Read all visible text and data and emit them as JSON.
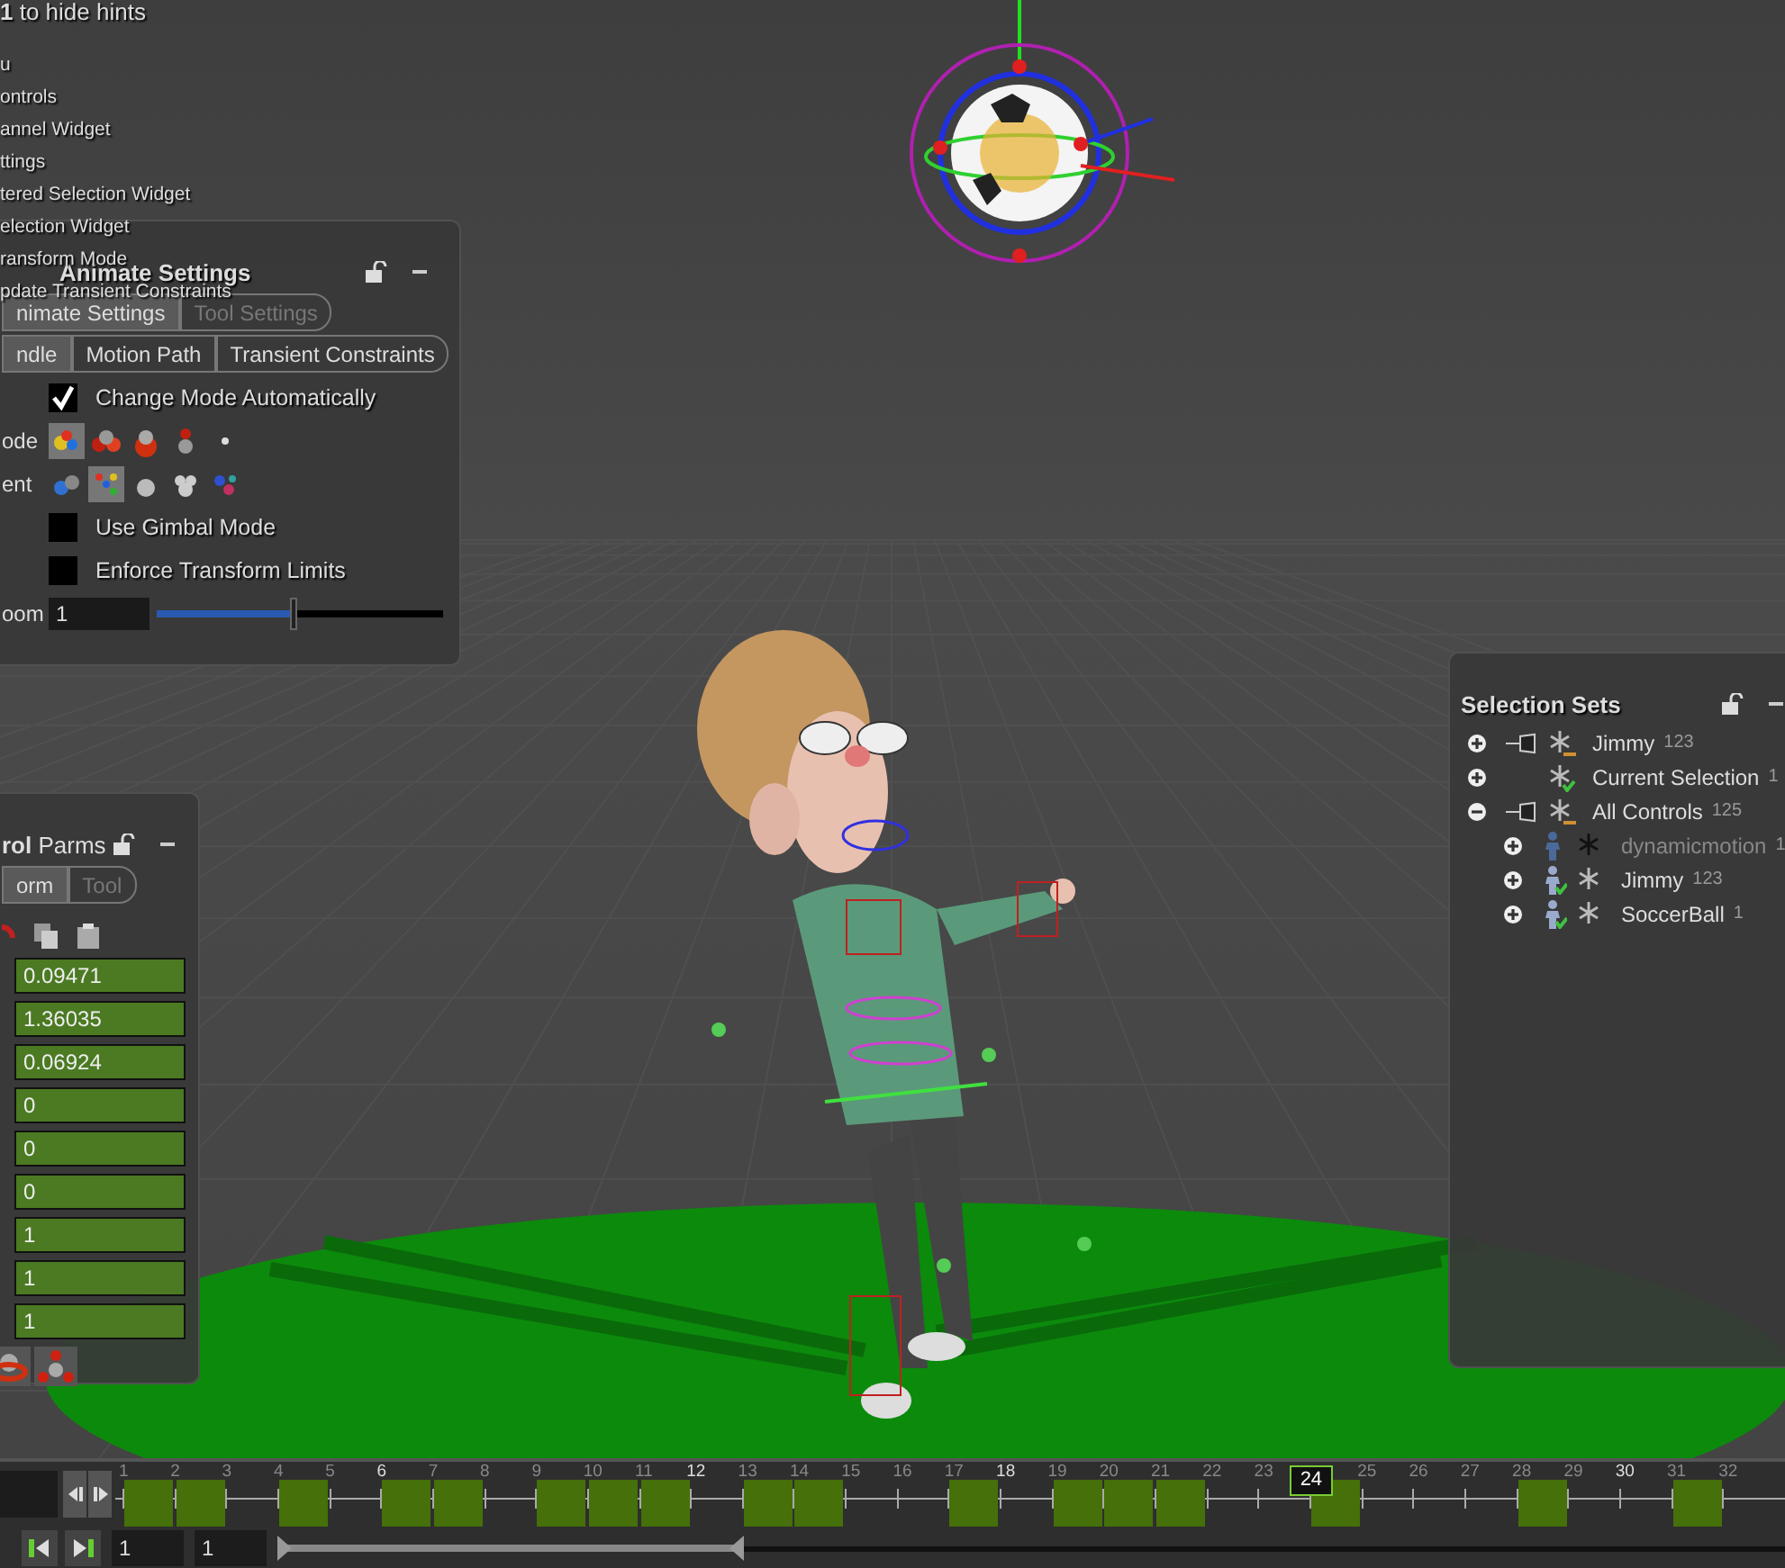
{
  "hints": {
    "title": "**1** to hide hints",
    "items": [
      "u",
      "ontrols",
      "annel Widget",
      "ttings",
      "tered Selection Widget",
      "election Widget",
      "ransform Mode",
      "pdate Transient Constraints"
    ]
  },
  "animate_settings": {
    "title": "Animate Settings",
    "tabs": [
      {
        "label": "nimate Settings",
        "selected": true
      },
      {
        "label": "Tool Settings",
        "selected": false
      }
    ],
    "subtabs": [
      {
        "label": "ndle",
        "selected": true
      },
      {
        "label": "Motion Path",
        "selected": false
      },
      {
        "label": "Transient Constraints",
        "selected": false
      }
    ],
    "rows": [
      {
        "kind": "checkbox",
        "label": "Change Mode Automatically",
        "checked": true
      },
      {
        "kind": "icons",
        "label": "ode",
        "icons": [
          {
            "selected": true
          },
          {
            "selected": false
          },
          {
            "selected": false
          },
          {
            "selected": false
          },
          {
            "selected": false
          }
        ]
      },
      {
        "kind": "icons",
        "label": "ent",
        "icons": [
          {
            "selected": false
          },
          {
            "selected": true
          },
          {
            "selected": false
          },
          {
            "selected": false
          },
          {
            "selected": false
          }
        ]
      },
      {
        "kind": "checkbox",
        "label": "Use Gimbal Mode",
        "checked": false
      },
      {
        "kind": "checkbox",
        "label": "Enforce Transform Limits",
        "checked": false
      },
      {
        "kind": "slider",
        "label": "oom",
        "value": "1",
        "level": 0.48
      }
    ]
  },
  "control_parms": {
    "title": "**rol** Parms",
    "tabs": [
      {
        "label": "orm",
        "selected": true
      },
      {
        "label": "Tool",
        "selected": false
      }
    ],
    "fields": [
      "0.09471",
      "1.36035",
      "0.06924",
      "0",
      "0",
      "0",
      "1",
      "1",
      "1"
    ]
  },
  "selection_sets": {
    "title": "Selection Sets",
    "items": [
      {
        "kind": "set",
        "label": "Jimmy",
        "count": "123",
        "expanded": false,
        "dimmed": false
      },
      {
        "kind": "selection",
        "label": "Current Selection",
        "count": "1",
        "expanded": false,
        "dimmed": false
      },
      {
        "kind": "set",
        "label": "All Controls",
        "count": "125",
        "expanded": true,
        "dimmed": false,
        "children": [
          {
            "kind": "character",
            "label": "dynamicmotion",
            "count": "1",
            "expanded": false,
            "dimmed": true
          },
          {
            "kind": "character",
            "label": "Jimmy",
            "count": "123",
            "expanded": false,
            "dimmed": false
          },
          {
            "kind": "character",
            "label": "SoccerBall",
            "count": "1",
            "expanded": false,
            "dimmed": false
          }
        ]
      }
    ]
  },
  "timeline": {
    "frames": [
      {
        "label": "1",
        "key": true,
        "selected": false
      },
      {
        "label": "2",
        "key": true,
        "selected": false
      },
      {
        "label": "3",
        "key": false,
        "selected": false
      },
      {
        "label": "4",
        "key": true,
        "selected": false
      },
      {
        "label": "5",
        "key": false,
        "selected": false
      },
      {
        "label": "6",
        "key": true,
        "selected": false
      },
      {
        "label": "7",
        "key": true,
        "selected": false
      },
      {
        "label": "8",
        "key": false,
        "selected": false
      },
      {
        "label": "9",
        "key": true,
        "selected": false
      },
      {
        "label": "10",
        "key": true,
        "selected": false
      },
      {
        "label": "11",
        "key": true,
        "selected": false
      },
      {
        "label": "12",
        "key": false,
        "selected": false
      },
      {
        "label": "13",
        "key": true,
        "selected": false
      },
      {
        "label": "14",
        "key": true,
        "selected": false
      },
      {
        "label": "15",
        "key": false,
        "selected": false
      },
      {
        "label": "16",
        "key": false,
        "selected": false
      },
      {
        "label": "17",
        "key": true,
        "selected": false
      },
      {
        "label": "18",
        "key": false,
        "selected": false
      },
      {
        "label": "19",
        "key": true,
        "selected": false
      },
      {
        "label": "20",
        "key": true,
        "selected": false
      },
      {
        "label": "21",
        "key": true,
        "selected": false
      },
      {
        "label": "22",
        "key": false,
        "selected": false
      },
      {
        "label": "23",
        "key": false,
        "selected": false
      },
      {
        "label": "24",
        "key": true,
        "selected": true
      },
      {
        "label": "25",
        "key": false,
        "selected": false
      },
      {
        "label": "26",
        "key": false,
        "selected": false
      },
      {
        "label": "27",
        "key": false,
        "selected": false
      },
      {
        "label": "28",
        "key": true,
        "selected": false
      },
      {
        "label": "29",
        "key": false,
        "selected": false
      },
      {
        "label": "30",
        "key": false,
        "selected": false
      },
      {
        "label": "31",
        "key": true,
        "selected": false
      },
      {
        "label": "32",
        "key": false,
        "selected": false
      }
    ],
    "start": "1",
    "end": "1",
    "range": {
      "level": 0.31
    }
  }
}
